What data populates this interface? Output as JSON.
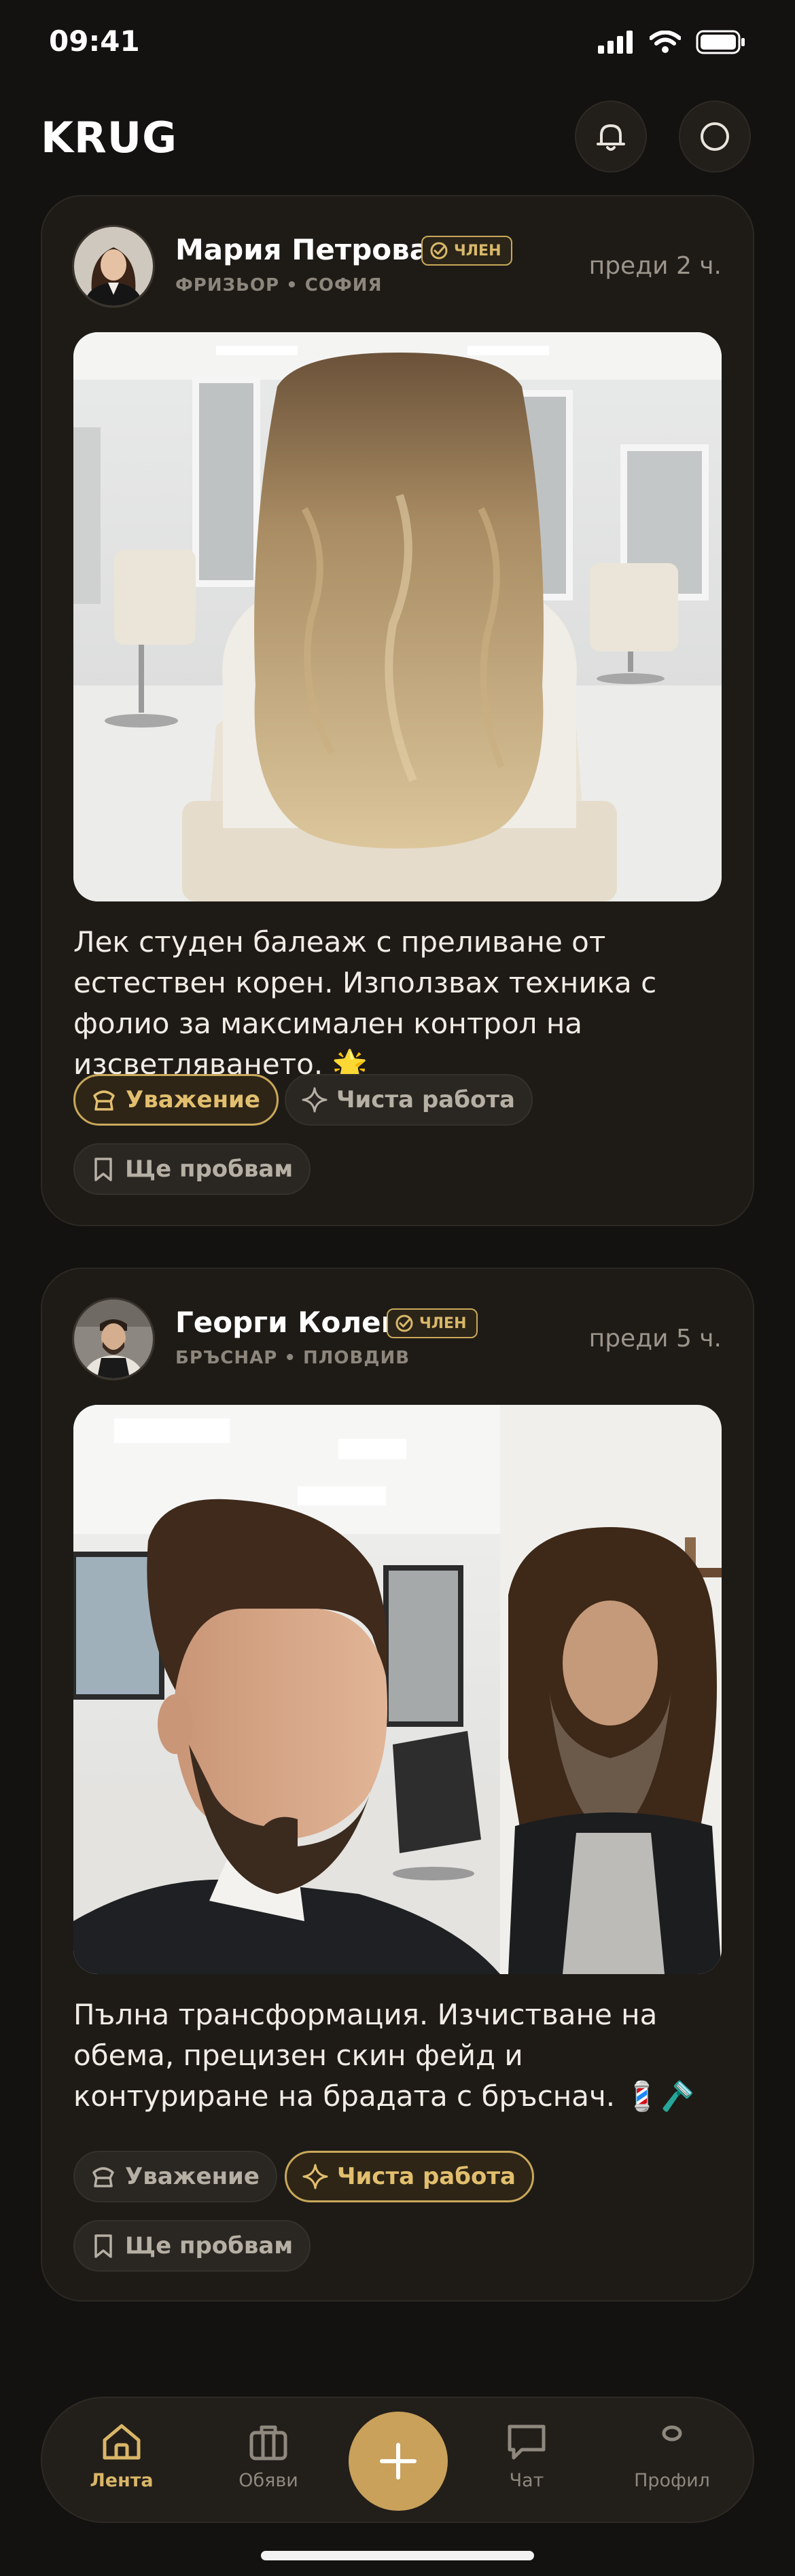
{
  "status": {
    "time": "09:41",
    "icons": [
      "signal-icon",
      "wifi-icon",
      "battery-icon"
    ]
  },
  "header": {
    "title": "KRUG",
    "icons": [
      "bell-icon",
      "profile-icon"
    ]
  },
  "colors": {
    "accent": "#c9a15b",
    "background": "#141210",
    "card": "#1e1b17"
  },
  "posts": [
    {
      "author": "Мария Петрова",
      "badge": "ЧЛЕН",
      "meta": "ФРИЗЬОР  •  СОФИЯ",
      "time": "преди 2 ч.",
      "text": "Лек студен балеаж с преливане от естествен корен. Използвах техника с фолио за максимален контрол на изсветляването. 🌟",
      "reactions": [
        {
          "label": "Уважение",
          "icon": "respect-icon",
          "active": true
        },
        {
          "label": "Чиста работа",
          "icon": "sparkle-icon",
          "active": false
        },
        {
          "label": "Ще пробвам",
          "icon": "bookmark-icon",
          "active": false
        }
      ]
    },
    {
      "author": "Георги Колев",
      "badge": "ЧЛЕН",
      "meta": "БРЪСНАР  •  ПЛОВДИВ",
      "time": "преди 5 ч.",
      "text": "Пълна трансформация. Изчистване на обема, прецизен скин фейд и контуриране на брадата с бръснач. 💈🪒",
      "reactions": [
        {
          "label": "Уважение",
          "icon": "respect-icon",
          "active": false
        },
        {
          "label": "Чиста работа",
          "icon": "sparkle-icon",
          "active": true
        },
        {
          "label": "Ще пробвам",
          "icon": "bookmark-icon",
          "active": false
        }
      ]
    }
  ],
  "nav": [
    {
      "label": "Лента",
      "icon": "home-icon",
      "active": true
    },
    {
      "label": "Обяви",
      "icon": "briefcase-icon",
      "active": false
    },
    {
      "label": "",
      "icon": "plus-icon",
      "active": false
    },
    {
      "label": "Чат",
      "icon": "chat-icon",
      "active": false
    },
    {
      "label": "Профил",
      "icon": "user-icon",
      "active": false
    }
  ]
}
